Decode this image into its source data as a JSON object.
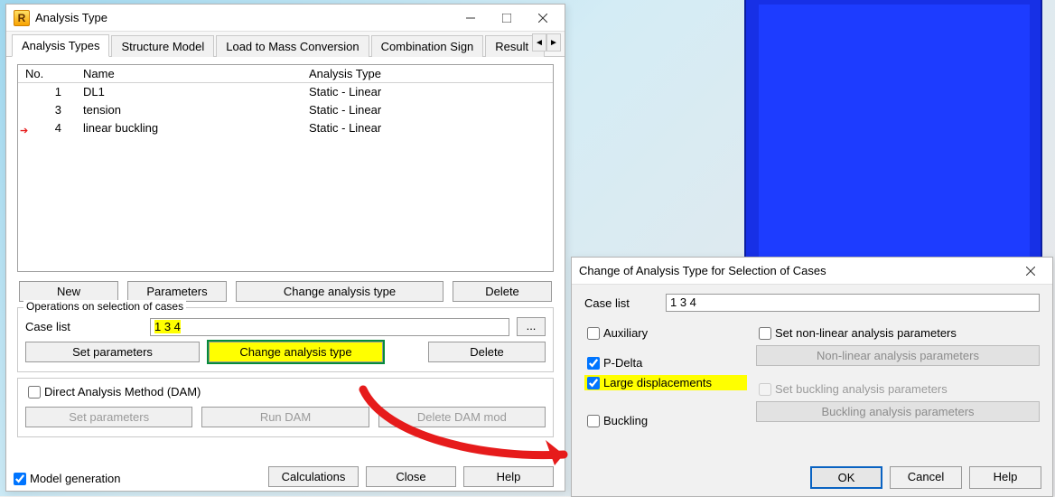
{
  "main_dialog": {
    "title": "Analysis Type",
    "app_icon_letter": "R",
    "tabs": {
      "active": "Analysis Types",
      "items": [
        "Analysis Types",
        "Structure Model",
        "Load to Mass Conversion",
        "Combination Sign",
        "Result I"
      ]
    },
    "list": {
      "headers": {
        "no": "No.",
        "name": "Name",
        "type": "Analysis Type"
      },
      "rows": [
        {
          "no": "1",
          "name": "DL1",
          "type": "Static - Linear",
          "marker": false
        },
        {
          "no": "3",
          "name": "tension",
          "type": "Static - Linear",
          "marker": false
        },
        {
          "no": "4",
          "name": "linear buckling",
          "type": "Static - Linear",
          "marker": true
        }
      ]
    },
    "buttons_row1": {
      "new": "New",
      "parameters": "Parameters",
      "change_type": "Change analysis type",
      "delete": "Delete"
    },
    "ops_group": {
      "label": "Operations on selection of cases",
      "case_list_label": "Case list",
      "case_list_value": "1 3 4",
      "ellipsis": "...",
      "set_params": "Set parameters",
      "change_type": "Change analysis type",
      "delete": "Delete"
    },
    "dam_group": {
      "checkbox_label": "Direct Analysis Method (DAM)",
      "set_params": "Set parameters",
      "run": "Run DAM",
      "delete": "Delete DAM mod"
    },
    "model_gen": "Model generation",
    "bottom": {
      "calculations": "Calculations",
      "close": "Close",
      "help": "Help"
    }
  },
  "change_dialog": {
    "title": "Change of Analysis Type for Selection of Cases",
    "case_list_label": "Case list",
    "case_list_value": "1 3 4",
    "checks": {
      "auxiliary": "Auxiliary",
      "pdelta": "P-Delta",
      "large_disp": "Large displacements",
      "buckling": "Buckling",
      "set_nonlinear": "Set non-linear analysis parameters",
      "set_buckling": "Set buckling analysis parameters"
    },
    "param_buttons": {
      "nonlinear": "Non-linear analysis parameters",
      "buckling": "Buckling analysis parameters"
    },
    "buttons": {
      "ok": "OK",
      "cancel": "Cancel",
      "help": "Help"
    }
  }
}
